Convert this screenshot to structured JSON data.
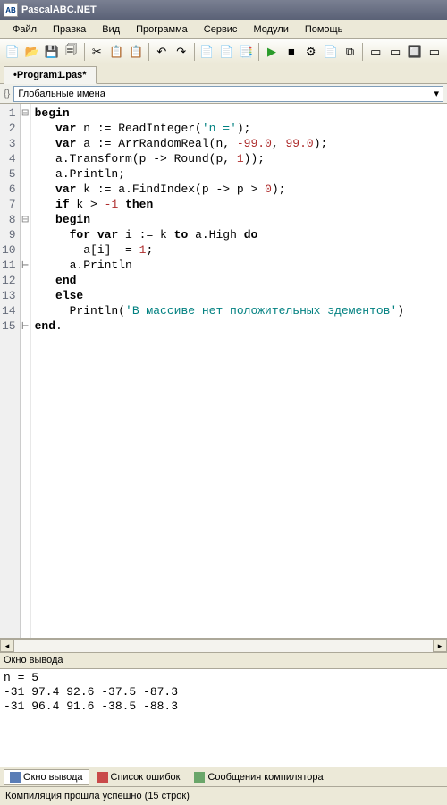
{
  "title": "PascalABC.NET",
  "menu": [
    "Файл",
    "Правка",
    "Вид",
    "Программа",
    "Сервис",
    "Модули",
    "Помощь"
  ],
  "tab_name": "•Program1.pas*",
  "scope_label": "Глобальные имена",
  "lines": [
    "1",
    "2",
    "3",
    "4",
    "5",
    "6",
    "7",
    "8",
    "9",
    "10",
    "11",
    "12",
    "13",
    "14",
    "15"
  ],
  "fold_marks": [
    "⊟",
    "",
    "",
    "",
    "",
    "",
    "",
    "⊟",
    "",
    "",
    "⊢",
    "",
    "",
    "",
    "⊢"
  ],
  "code": [
    [
      {
        "t": "begin",
        "c": "kw"
      }
    ],
    [
      {
        "t": "   "
      },
      {
        "t": "var",
        "c": "kw"
      },
      {
        "t": " n := ReadInteger("
      },
      {
        "t": "'n ='",
        "c": "str"
      },
      {
        "t": ");"
      }
    ],
    [
      {
        "t": "   "
      },
      {
        "t": "var",
        "c": "kw"
      },
      {
        "t": " a := ArrRandomReal(n, "
      },
      {
        "t": "-99.0",
        "c": "num"
      },
      {
        "t": ", "
      },
      {
        "t": "99.0",
        "c": "num"
      },
      {
        "t": ");"
      }
    ],
    [
      {
        "t": "   a.Transform(p -> Round(p, "
      },
      {
        "t": "1",
        "c": "num"
      },
      {
        "t": "));"
      }
    ],
    [
      {
        "t": "   a.Println;"
      }
    ],
    [
      {
        "t": "   "
      },
      {
        "t": "var",
        "c": "kw"
      },
      {
        "t": " k := a.FindIndex(p -> p > "
      },
      {
        "t": "0",
        "c": "num"
      },
      {
        "t": ");"
      }
    ],
    [
      {
        "t": "   "
      },
      {
        "t": "if",
        "c": "kw"
      },
      {
        "t": " k > "
      },
      {
        "t": "-1",
        "c": "num"
      },
      {
        "t": " "
      },
      {
        "t": "then",
        "c": "kw"
      }
    ],
    [
      {
        "t": "   "
      },
      {
        "t": "begin",
        "c": "kw"
      }
    ],
    [
      {
        "t": "     "
      },
      {
        "t": "for",
        "c": "kw"
      },
      {
        "t": " "
      },
      {
        "t": "var",
        "c": "kw"
      },
      {
        "t": " i := k "
      },
      {
        "t": "to",
        "c": "kw"
      },
      {
        "t": " a.High "
      },
      {
        "t": "do",
        "c": "kw"
      }
    ],
    [
      {
        "t": "       a[i] -= "
      },
      {
        "t": "1",
        "c": "num"
      },
      {
        "t": ";"
      }
    ],
    [
      {
        "t": "     a.Println"
      }
    ],
    [
      {
        "t": "   "
      },
      {
        "t": "end",
        "c": "kw"
      }
    ],
    [
      {
        "t": "   "
      },
      {
        "t": "else",
        "c": "kw"
      }
    ],
    [
      {
        "t": "     Println("
      },
      {
        "t": "'В массиве нет положительных эдементов'",
        "c": "str"
      },
      {
        "t": ")"
      }
    ],
    [
      {
        "t": "end",
        "c": "kw"
      },
      {
        "t": "."
      }
    ]
  ],
  "out_header": "Окно вывода",
  "output_lines": [
    "n = 5",
    "-31 97.4 92.6 -37.5 -87.3",
    "-31 96.4 91.6 -38.5 -88.3",
    " ",
    " ",
    " "
  ],
  "btabs": [
    {
      "label": "Окно вывода",
      "icon_color": "#5a7db6",
      "active": true
    },
    {
      "label": "Список ошибок",
      "icon_color": "#c94a4a",
      "active": false
    },
    {
      "label": "Сообщения компилятора",
      "icon_color": "#6aa66a",
      "active": false
    }
  ],
  "status": "Компиляция прошла успешно (15 строк)",
  "toolbar_icons": [
    "📄",
    "📂",
    "💾",
    "🗐",
    "✂",
    "📋",
    "📋",
    "↶",
    "↷",
    "📄",
    "📄",
    "📑",
    "▶",
    "■",
    "⚙",
    "📄",
    "⧉",
    "▭",
    "▭",
    "🔲",
    "▭"
  ]
}
